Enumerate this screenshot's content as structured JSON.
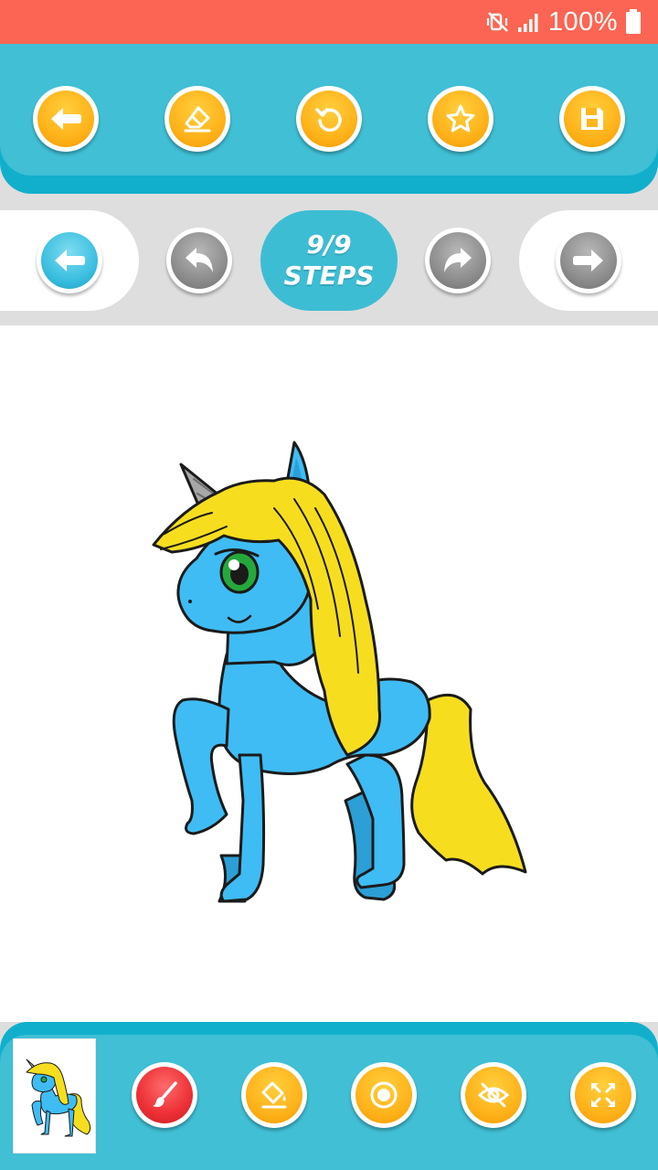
{
  "status_bar": {
    "battery_text": "100%",
    "icons": [
      "mute-vibrate-icon",
      "signal-icon",
      "battery-icon"
    ]
  },
  "top_toolbar": {
    "buttons": [
      {
        "name": "back",
        "icon": "arrow-left-icon"
      },
      {
        "name": "eraser",
        "icon": "eraser-icon"
      },
      {
        "name": "reset",
        "icon": "refresh-icon"
      },
      {
        "name": "favorite",
        "icon": "star-icon"
      },
      {
        "name": "save",
        "icon": "floppy-disk-icon"
      }
    ]
  },
  "steps": {
    "counter": "9/9",
    "label": "STEPS",
    "buttons": [
      {
        "name": "first-step",
        "icon": "arrow-left-icon",
        "color": "#3cbfe0"
      },
      {
        "name": "undo-step",
        "icon": "undo-icon",
        "color": "#8d8d8d"
      },
      {
        "name": "redo-step",
        "icon": "redo-icon",
        "color": "#8d8d8d"
      },
      {
        "name": "last-step",
        "icon": "arrow-right-icon",
        "color": "#8d8d8d"
      }
    ]
  },
  "canvas": {
    "drawing": "unicorn-illustration",
    "colors": {
      "body": "#3fbcf4",
      "mane": "#f6de1f",
      "eye": "#25a83b",
      "horn": "#a7a7a7",
      "outline": "#1b1b1b"
    }
  },
  "bottom_toolbar": {
    "thumbnail": "unicorn-thumbnail",
    "buttons": [
      {
        "name": "brush",
        "icon": "brush-icon",
        "color": "#ec2f35"
      },
      {
        "name": "fill",
        "icon": "paint-bucket-icon",
        "color": "#ffb51d"
      },
      {
        "name": "brush-size",
        "icon": "circle-dot-icon",
        "color": "#ffb51d"
      },
      {
        "name": "hide-guide",
        "icon": "eye-off-icon",
        "color": "#ffb51d"
      },
      {
        "name": "fullscreen",
        "icon": "expand-icon",
        "color": "#ffb51d"
      }
    ]
  },
  "theme": {
    "status_bar": "#fc6553",
    "toolbar": "#40bfd5",
    "toolbar_shadow": "#11afcc",
    "background": "#dedede",
    "button_orange": "#ffb51d"
  }
}
